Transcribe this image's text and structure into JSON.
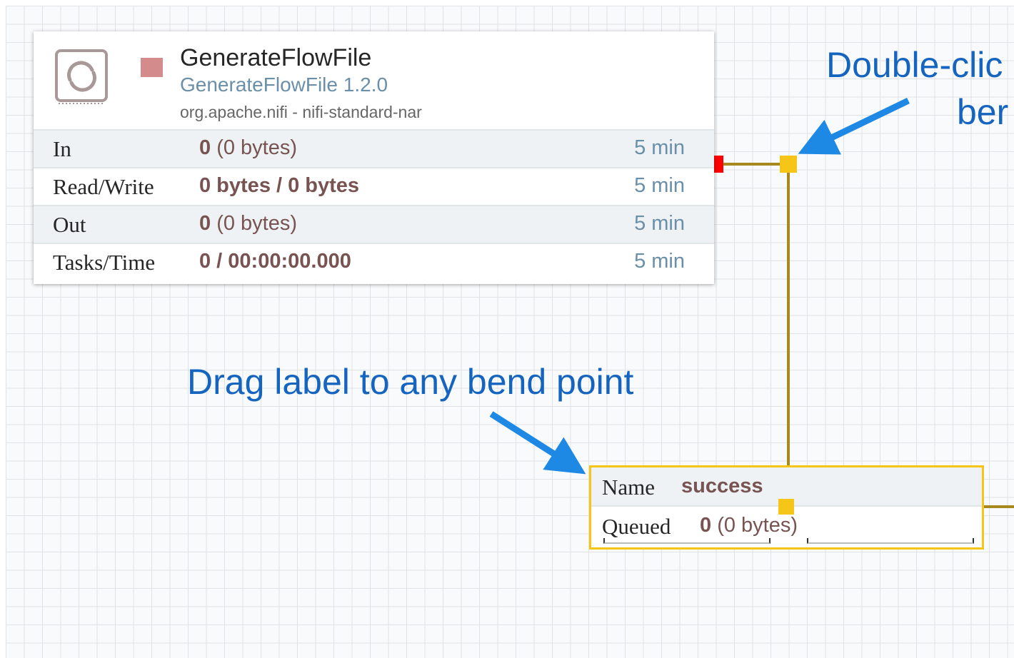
{
  "processor": {
    "name": "GenerateFlowFile",
    "type": "GenerateFlowFile 1.2.0",
    "bundle": "org.apache.nifi - nifi-standard-nar",
    "stats": [
      {
        "label": "In",
        "value_bold": "0",
        "value_rest": " (0 bytes)",
        "time": "5 min"
      },
      {
        "label": "Read/Write",
        "value_bold": "0 bytes / 0 bytes",
        "value_rest": "",
        "time": "5 min"
      },
      {
        "label": "Out",
        "value_bold": "0",
        "value_rest": " (0 bytes)",
        "time": "5 min"
      },
      {
        "label": "Tasks/Time",
        "value_bold": "0 / 00:00:00.000",
        "value_rest": "",
        "time": "5 min"
      }
    ]
  },
  "connection": {
    "name_label": "Name",
    "name_value": "success",
    "queued_label": "Queued",
    "queued_bold": "0",
    "queued_rest": " (0 bytes)"
  },
  "annotations": {
    "top_line1": "Double-clic",
    "top_line2": "ber",
    "drag_label": "Drag label to any bend point"
  },
  "colors": {
    "connection_line": "#a8891e",
    "bend_point": "#f5c518",
    "source_anchor": "#ff0000",
    "annotation_text": "#1565c0",
    "arrow": "#1e88e5",
    "stopped_status": "#d48b8b"
  }
}
